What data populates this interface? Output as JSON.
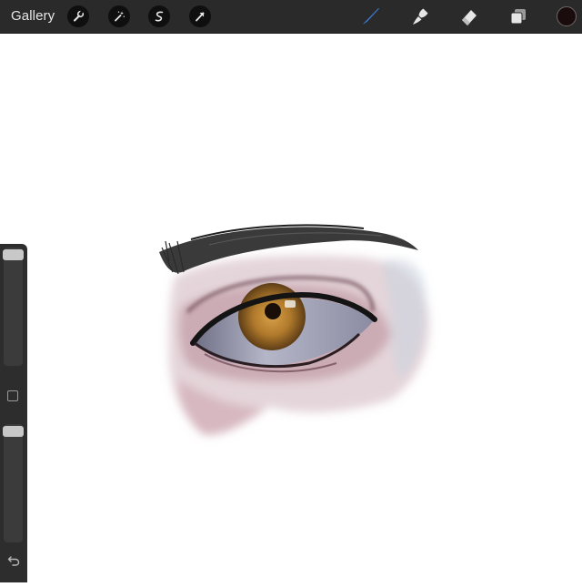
{
  "topbar": {
    "gallery_label": "Gallery",
    "left_tools": [
      "actions-wrench-icon",
      "adjustments-wand-icon",
      "selection-s-icon",
      "transform-arrow-icon"
    ],
    "right_tools": [
      "brush-icon",
      "smudge-icon",
      "eraser-icon",
      "layers-icon"
    ],
    "active_tool": "brush-icon",
    "active_color": "#1a0c0c",
    "accent_color": "#3d7bd6"
  },
  "sidebar": {
    "brush_size_level": 0.02,
    "brush_opacity_level": 0.02,
    "modify_button": "modify-square-icon",
    "undo_button": "undo-arrow-icon"
  },
  "canvas": {
    "artwork": "eye-drawing"
  }
}
